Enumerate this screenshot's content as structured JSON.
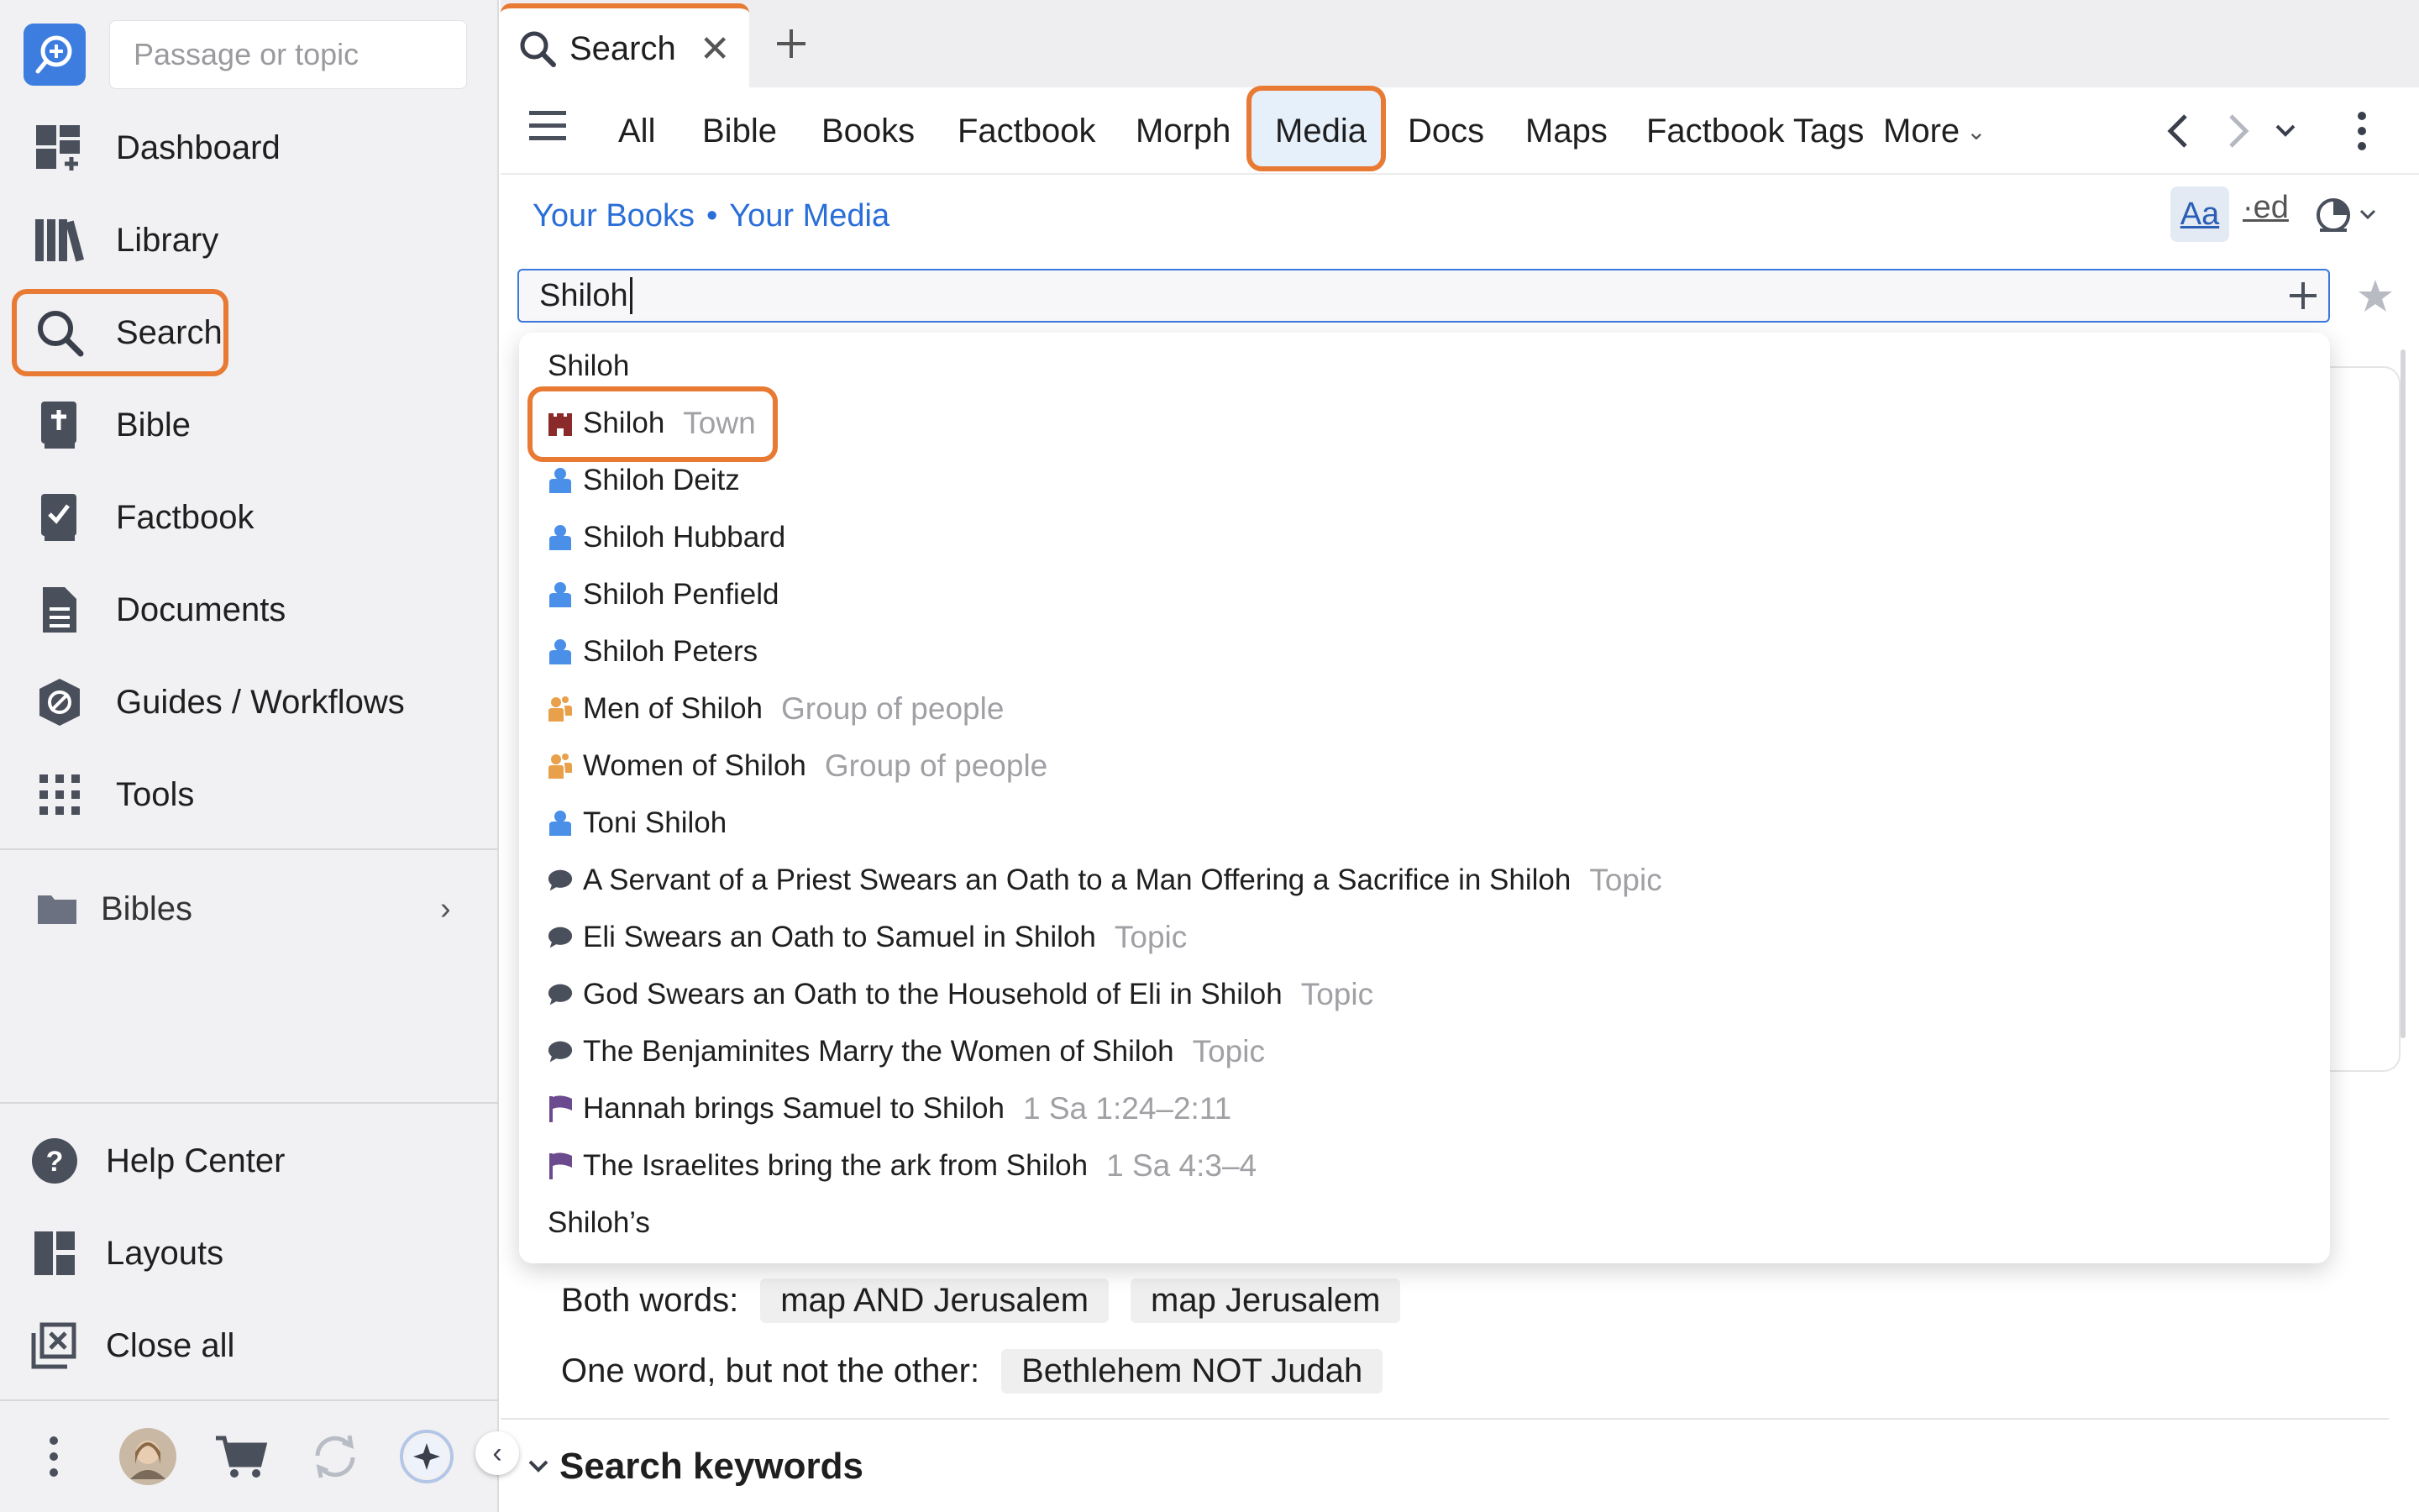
{
  "sidebar": {
    "search_placeholder": "Passage or topic",
    "items": [
      {
        "label": "Dashboard",
        "icon": "dashboard-icon"
      },
      {
        "label": "Library",
        "icon": "library-icon"
      },
      {
        "label": "Search",
        "icon": "search-icon"
      },
      {
        "label": "Bible",
        "icon": "bible-icon"
      },
      {
        "label": "Factbook",
        "icon": "factbook-icon"
      },
      {
        "label": "Documents",
        "icon": "documents-icon"
      },
      {
        "label": "Guides / Workflows",
        "icon": "guides-icon"
      },
      {
        "label": "Tools",
        "icon": "tools-icon"
      }
    ],
    "bibles_label": "Bibles",
    "bottom_items": [
      {
        "label": "Help Center",
        "icon": "help-icon"
      },
      {
        "label": "Layouts",
        "icon": "layouts-icon"
      },
      {
        "label": "Close all",
        "icon": "close-all-icon"
      }
    ]
  },
  "tabs": {
    "active_label": "Search"
  },
  "filters": {
    "items": [
      "All",
      "Bible",
      "Books",
      "Factbook",
      "Morph",
      "Media",
      "Docs",
      "Maps",
      "Factbook Tags",
      "More"
    ],
    "active": "Media"
  },
  "breadcrumb": {
    "first": "Your Books",
    "separator": "•",
    "second": "Your Media"
  },
  "toolbar": {
    "aa_label": "Aa",
    "ed_label": "·ed"
  },
  "search": {
    "value": "Shiloh"
  },
  "suggestions": [
    {
      "label": "Shiloh",
      "meta": "",
      "icon": "none"
    },
    {
      "label": "Shiloh",
      "meta": "Town",
      "icon": "town-icon"
    },
    {
      "label": "Shiloh Deitz",
      "meta": "",
      "icon": "person-icon"
    },
    {
      "label": "Shiloh Hubbard",
      "meta": "",
      "icon": "person-icon"
    },
    {
      "label": "Shiloh Penfield",
      "meta": "",
      "icon": "person-icon"
    },
    {
      "label": "Shiloh Peters",
      "meta": "",
      "icon": "person-icon"
    },
    {
      "label": "Men of Shiloh",
      "meta": "Group of people",
      "icon": "group-icon"
    },
    {
      "label": "Women of Shiloh",
      "meta": "Group of people",
      "icon": "group-icon"
    },
    {
      "label": "Toni Shiloh",
      "meta": "",
      "icon": "person-icon"
    },
    {
      "label": "A Servant of a Priest Swears an Oath to a Man Offering a Sacrifice in Shiloh",
      "meta": "Topic",
      "icon": "topic-icon"
    },
    {
      "label": "Eli Swears an Oath to Samuel in Shiloh",
      "meta": "Topic",
      "icon": "topic-icon"
    },
    {
      "label": "God Swears an Oath to the Household of Eli in Shiloh",
      "meta": "Topic",
      "icon": "topic-icon"
    },
    {
      "label": "The Benjaminites Marry the Women of Shiloh",
      "meta": "Topic",
      "icon": "topic-icon"
    },
    {
      "label": "Hannah brings Samuel to Shiloh",
      "meta": "1 Sa 1:24–2:11",
      "icon": "event-flag-icon"
    },
    {
      "label": "The Israelites bring the ark from Shiloh",
      "meta": "1 Sa 4:3–4",
      "icon": "event-flag-icon"
    },
    {
      "label": "Shiloh’s",
      "meta": "",
      "icon": "none"
    }
  ],
  "examples": {
    "both_label": "Both words:",
    "both_chips": [
      "map AND Jerusalem",
      "map Jerusalem"
    ],
    "one_label": "One word, but not the other:",
    "one_chips": [
      "Bethlehem NOT Judah"
    ]
  },
  "section": {
    "keywords_heading": "Search keywords"
  },
  "colors": {
    "highlight": "#e87a34",
    "link": "#2a6ed8",
    "person": "#4a8fe8",
    "group": "#e8a04a",
    "town": "#8b2a2a",
    "topic": "#4a4f5c",
    "event": "#6b4a8e"
  }
}
